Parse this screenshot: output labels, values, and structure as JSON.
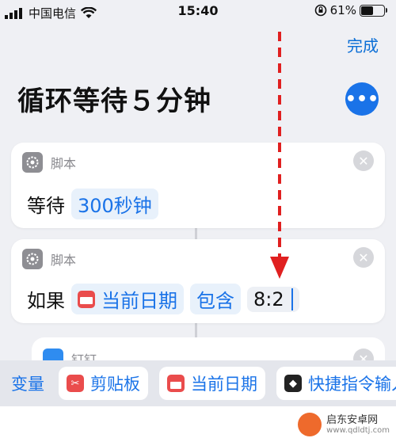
{
  "status": {
    "carrier": "中国电信",
    "time": "15:40",
    "battery_pct": "61%",
    "battery_level": 0.61,
    "icons": [
      "signal-icon",
      "wifi-icon",
      "rotation-lock-icon",
      "battery-icon"
    ]
  },
  "header": {
    "done_label": "完成",
    "title": "循环等待５分钟",
    "more_icon": "ellipsis-icon"
  },
  "cards": [
    {
      "category": "脚本",
      "verb": "等待",
      "value": "300秒钟"
    },
    {
      "category": "脚本",
      "verb": "如果",
      "subject": "当前日期",
      "operator": "包含",
      "input": "8:2"
    },
    {
      "category": "钉钉"
    }
  ],
  "variables_bar": {
    "label": "变量",
    "chips": [
      {
        "label": "剪贴板",
        "icon": "scissors-icon"
      },
      {
        "label": "当前日期",
        "icon": "calendar-icon"
      },
      {
        "label": "快捷指令输入",
        "icon": "shortcuts-icon"
      }
    ]
  },
  "watermark": {
    "name": "启东安卓网",
    "url": "www.qdldtj.com"
  },
  "colors": {
    "accent": "#1a73e8",
    "calendar": "#ea4c4c",
    "arrow": "#e02020"
  }
}
